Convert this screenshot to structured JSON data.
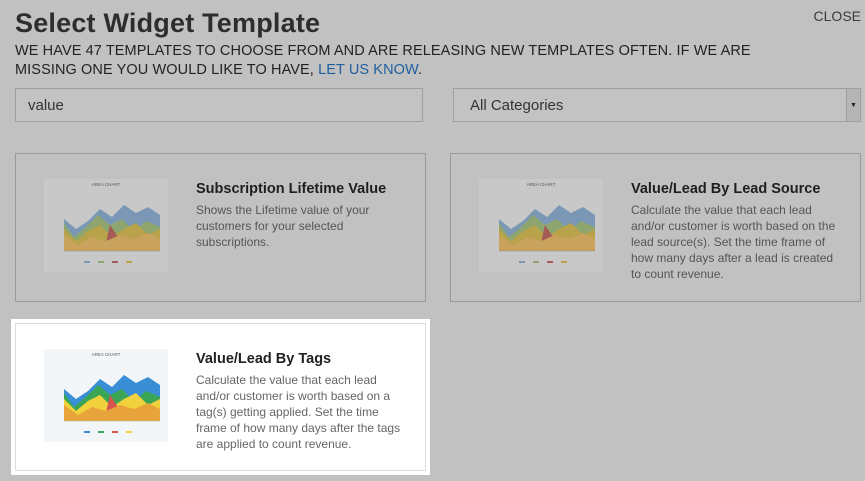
{
  "header": {
    "title": "Select Widget Template",
    "close_label": "CLOSE"
  },
  "intro": {
    "text": "WE HAVE 47 TEMPLATES TO CHOOSE FROM AND ARE RELEASING NEW TEMPLATES OFTEN. IF WE ARE MISSING ONE YOU WOULD LIKE TO HAVE,",
    "link_label": "LET US KNOW",
    "suffix": "."
  },
  "search": {
    "value": "value"
  },
  "category_filter": {
    "selected": "All Categories"
  },
  "templates": [
    {
      "title": "Subscription Lifetime Value",
      "description": "Shows the Lifetime value of your customers for your selected subscriptions.",
      "thumbnail_title": "AREA CHART",
      "highlighted": false
    },
    {
      "title": "Value/Lead By Lead Source",
      "description": "Calculate the value that each lead and/or customer is worth based on the lead source(s). Set the time frame of how many days after a lead is created to count revenue.",
      "thumbnail_title": "AREA CHART",
      "highlighted": false
    },
    {
      "title": "Value/Lead By Tags",
      "description": "Calculate the value that each lead and/or customer is worth based on a tag(s) getting applied. Set the time frame of how many days after the tags are applied to count revenue.",
      "thumbnail_title": "AREA CHART",
      "highlighted": true
    }
  ],
  "colors": {
    "overlay_bg": "#c1c1c1",
    "link": "#1f5f9e",
    "series_yellow": "#f2d23c",
    "series_green": "#3aa655",
    "series_blue": "#3a8ed6",
    "series_red": "#d9534f",
    "series_orange": "#e8a33a"
  }
}
